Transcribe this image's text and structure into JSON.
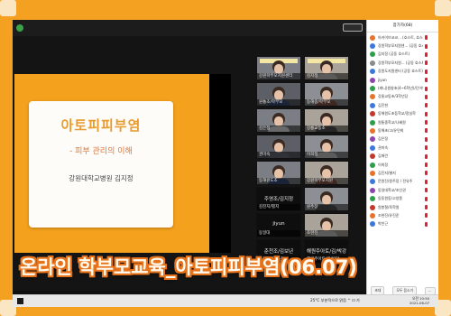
{
  "caption": "온라인 학부모교육_아토피피부염(06.07)",
  "slide": {
    "title": "아토피피부염",
    "subtitle": "- 피부 관리의 이해",
    "author": "강원대학교병원 김지정"
  },
  "panel": {
    "title": "참가자(68)",
    "footer": [
      "초대",
      "모두 음소거",
      "···"
    ],
    "participants": [
      {
        "name": "아카이브코코... (호스트, 호스트)",
        "color": "#e5732b"
      },
      {
        "name": "강원학부모지원센... (공동 호스트)",
        "color": "#3c78d8"
      },
      {
        "name": "김지정 (공동 호스트)",
        "color": "#2f9e4a"
      },
      {
        "name": "강원학부모지원... (공동 호스트)",
        "color": "#8a8a8a"
      },
      {
        "name": "강원도지원센터 (공동 호스트)",
        "color": "#3c78d8"
      },
      {
        "name": "jiyun",
        "color": "#8e44ad"
      },
      {
        "name": "(캐니)원창초(4~6학년)/단어단...",
        "color": "#2f9e4a"
      },
      {
        "name": "강릉교동초/3학년당",
        "color": "#e5732b"
      },
      {
        "name": "김진현",
        "color": "#3c78d8"
      },
      {
        "name": "동해원도초등학교/정실학",
        "color": "#c0392b"
      },
      {
        "name": "원통중학교/나혜원",
        "color": "#2f9e4a"
      },
      {
        "name": "동해초/고/유민희",
        "color": "#e5732b"
      },
      {
        "name": "김은정",
        "color": "#8e44ad"
      },
      {
        "name": "권미숙",
        "color": "#3c78d8"
      },
      {
        "name": "김애란",
        "color": "#c0392b"
      },
      {
        "name": "이희정",
        "color": "#2f9e4a"
      },
      {
        "name": "김진지/별지",
        "color": "#e5732b"
      },
      {
        "name": "문원진/원주장 / 전유주",
        "color": "#3c78d8"
      },
      {
        "name": "동일대학교/조인권",
        "color": "#8e44ad"
      },
      {
        "name": "동동원동/고양종",
        "color": "#2f9e4a"
      },
      {
        "name": "원봉철/육학원",
        "color": "#c0392b"
      },
      {
        "name": "조현진/유진준",
        "color": "#e5732b"
      },
      {
        "name": "박찬근",
        "color": "#3c78d8"
      }
    ]
  },
  "gallery": [
    {
      "name": "강원학부모지원센터",
      "type": "person"
    },
    {
      "name": "김지정",
      "type": "person"
    },
    {
      "name": "원통초/학부모",
      "type": "person"
    },
    {
      "name": "동해중/학부모",
      "type": "person"
    },
    {
      "name": "김은정",
      "type": "person"
    },
    {
      "name": "강릉교동초",
      "type": "person"
    },
    {
      "name": "권미숙",
      "type": "person"
    },
    {
      "name": "이희정",
      "type": "person"
    },
    {
      "name": "동해원도초",
      "type": "person"
    },
    {
      "name": "강원학부모지원",
      "type": "person"
    },
    {
      "name": "김진지/별지",
      "type": "dark",
      "big": "주영조/김지정"
    },
    {
      "name": "원주장",
      "type": "person"
    },
    {
      "name": "동일대",
      "type": "dark",
      "big": "jiyun"
    },
    {
      "name": "조현진",
      "type": "person"
    },
    {
      "name": "춘천조/김보년",
      "type": "dark",
      "big": "춘천조/김보년"
    },
    {
      "name": "해원주아토/김/박강",
      "type": "dark",
      "big": "해원주아토/김/박강"
    }
  ],
  "taskbar": {
    "tray": "25°C 부분적으로 맑음  ^  ⊡  가",
    "time": "오전 10:50",
    "date": "2021-06-07"
  }
}
